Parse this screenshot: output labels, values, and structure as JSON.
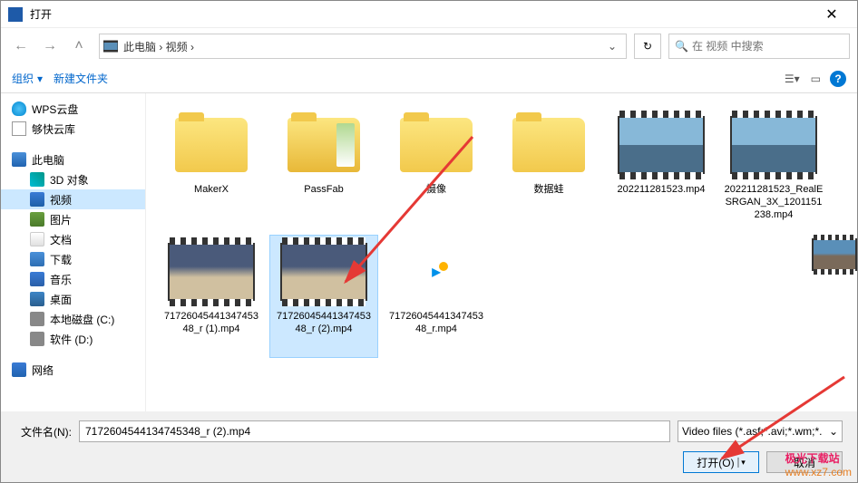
{
  "titlebar": {
    "title": "打开"
  },
  "address": {
    "path": "此电脑 › 视频 ›",
    "search_placeholder": "在 视频 中搜索"
  },
  "toolbar": {
    "organize": "组织",
    "new_folder": "新建文件夹"
  },
  "sidebar": {
    "items": [
      {
        "label": "WPS云盘",
        "icon": "icon-cloud",
        "indent": false
      },
      {
        "label": "够快云库",
        "icon": "icon-doc",
        "indent": false
      },
      {
        "label": "此电脑",
        "icon": "icon-pc",
        "indent": false,
        "spacer_before": true
      },
      {
        "label": "3D 对象",
        "icon": "icon-3d",
        "indent": true
      },
      {
        "label": "视频",
        "icon": "icon-video",
        "indent": true,
        "active": true
      },
      {
        "label": "图片",
        "icon": "icon-image",
        "indent": true
      },
      {
        "label": "文档",
        "icon": "icon-document",
        "indent": true
      },
      {
        "label": "下载",
        "icon": "icon-download",
        "indent": true
      },
      {
        "label": "音乐",
        "icon": "icon-music",
        "indent": true
      },
      {
        "label": "桌面",
        "icon": "icon-desktop",
        "indent": true
      },
      {
        "label": "本地磁盘 (C:)",
        "icon": "icon-disk",
        "indent": true
      },
      {
        "label": "软件 (D:)",
        "icon": "icon-disk",
        "indent": true
      },
      {
        "label": "网络",
        "icon": "icon-network",
        "indent": false,
        "spacer_before": true
      }
    ]
  },
  "files": [
    {
      "label": "MakerX",
      "type": "folder"
    },
    {
      "label": "PassFab",
      "type": "folder-open"
    },
    {
      "label": "摄像",
      "type": "folder"
    },
    {
      "label": "数据蛙",
      "type": "folder"
    },
    {
      "label": "202211281523.mp4",
      "type": "video-landscape"
    },
    {
      "label": "202211281523_RealESRGAN_3X_1201151238.mp4",
      "type": "video-landscape"
    },
    {
      "label": "7172604544134745348_r (1).mp4",
      "type": "video-night"
    },
    {
      "label": "7172604544134745348_r (2).mp4",
      "type": "video-night",
      "selected": true
    },
    {
      "label": "7172604544134745348_r.mp4",
      "type": "app"
    }
  ],
  "footer": {
    "filename_label": "文件名(N):",
    "filename_value": "7172604544134745348_r (2).mp4",
    "filter_value": "Video files (*.asf;*.avi;*.wm;*.",
    "open_label": "打开(O)",
    "cancel_label": "取消"
  },
  "watermark": {
    "top": "极光下载站",
    "bottom": "www.xz7.com"
  }
}
